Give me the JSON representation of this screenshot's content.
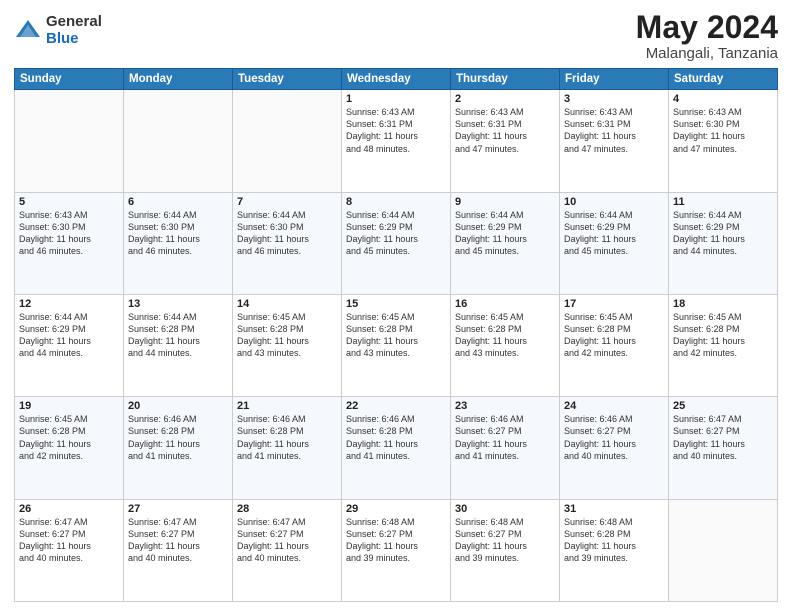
{
  "logo": {
    "general": "General",
    "blue": "Blue"
  },
  "title": "May 2024",
  "subtitle": "Malangali, Tanzania",
  "days_of_week": [
    "Sunday",
    "Monday",
    "Tuesday",
    "Wednesday",
    "Thursday",
    "Friday",
    "Saturday"
  ],
  "weeks": [
    [
      {
        "day": "",
        "info": ""
      },
      {
        "day": "",
        "info": ""
      },
      {
        "day": "",
        "info": ""
      },
      {
        "day": "1",
        "info": "Sunrise: 6:43 AM\nSunset: 6:31 PM\nDaylight: 11 hours\nand 48 minutes."
      },
      {
        "day": "2",
        "info": "Sunrise: 6:43 AM\nSunset: 6:31 PM\nDaylight: 11 hours\nand 47 minutes."
      },
      {
        "day": "3",
        "info": "Sunrise: 6:43 AM\nSunset: 6:31 PM\nDaylight: 11 hours\nand 47 minutes."
      },
      {
        "day": "4",
        "info": "Sunrise: 6:43 AM\nSunset: 6:30 PM\nDaylight: 11 hours\nand 47 minutes."
      }
    ],
    [
      {
        "day": "5",
        "info": "Sunrise: 6:43 AM\nSunset: 6:30 PM\nDaylight: 11 hours\nand 46 minutes."
      },
      {
        "day": "6",
        "info": "Sunrise: 6:44 AM\nSunset: 6:30 PM\nDaylight: 11 hours\nand 46 minutes."
      },
      {
        "day": "7",
        "info": "Sunrise: 6:44 AM\nSunset: 6:30 PM\nDaylight: 11 hours\nand 46 minutes."
      },
      {
        "day": "8",
        "info": "Sunrise: 6:44 AM\nSunset: 6:29 PM\nDaylight: 11 hours\nand 45 minutes."
      },
      {
        "day": "9",
        "info": "Sunrise: 6:44 AM\nSunset: 6:29 PM\nDaylight: 11 hours\nand 45 minutes."
      },
      {
        "day": "10",
        "info": "Sunrise: 6:44 AM\nSunset: 6:29 PM\nDaylight: 11 hours\nand 45 minutes."
      },
      {
        "day": "11",
        "info": "Sunrise: 6:44 AM\nSunset: 6:29 PM\nDaylight: 11 hours\nand 44 minutes."
      }
    ],
    [
      {
        "day": "12",
        "info": "Sunrise: 6:44 AM\nSunset: 6:29 PM\nDaylight: 11 hours\nand 44 minutes."
      },
      {
        "day": "13",
        "info": "Sunrise: 6:44 AM\nSunset: 6:28 PM\nDaylight: 11 hours\nand 44 minutes."
      },
      {
        "day": "14",
        "info": "Sunrise: 6:45 AM\nSunset: 6:28 PM\nDaylight: 11 hours\nand 43 minutes."
      },
      {
        "day": "15",
        "info": "Sunrise: 6:45 AM\nSunset: 6:28 PM\nDaylight: 11 hours\nand 43 minutes."
      },
      {
        "day": "16",
        "info": "Sunrise: 6:45 AM\nSunset: 6:28 PM\nDaylight: 11 hours\nand 43 minutes."
      },
      {
        "day": "17",
        "info": "Sunrise: 6:45 AM\nSunset: 6:28 PM\nDaylight: 11 hours\nand 42 minutes."
      },
      {
        "day": "18",
        "info": "Sunrise: 6:45 AM\nSunset: 6:28 PM\nDaylight: 11 hours\nand 42 minutes."
      }
    ],
    [
      {
        "day": "19",
        "info": "Sunrise: 6:45 AM\nSunset: 6:28 PM\nDaylight: 11 hours\nand 42 minutes."
      },
      {
        "day": "20",
        "info": "Sunrise: 6:46 AM\nSunset: 6:28 PM\nDaylight: 11 hours\nand 41 minutes."
      },
      {
        "day": "21",
        "info": "Sunrise: 6:46 AM\nSunset: 6:28 PM\nDaylight: 11 hours\nand 41 minutes."
      },
      {
        "day": "22",
        "info": "Sunrise: 6:46 AM\nSunset: 6:28 PM\nDaylight: 11 hours\nand 41 minutes."
      },
      {
        "day": "23",
        "info": "Sunrise: 6:46 AM\nSunset: 6:27 PM\nDaylight: 11 hours\nand 41 minutes."
      },
      {
        "day": "24",
        "info": "Sunrise: 6:46 AM\nSunset: 6:27 PM\nDaylight: 11 hours\nand 40 minutes."
      },
      {
        "day": "25",
        "info": "Sunrise: 6:47 AM\nSunset: 6:27 PM\nDaylight: 11 hours\nand 40 minutes."
      }
    ],
    [
      {
        "day": "26",
        "info": "Sunrise: 6:47 AM\nSunset: 6:27 PM\nDaylight: 11 hours\nand 40 minutes."
      },
      {
        "day": "27",
        "info": "Sunrise: 6:47 AM\nSunset: 6:27 PM\nDaylight: 11 hours\nand 40 minutes."
      },
      {
        "day": "28",
        "info": "Sunrise: 6:47 AM\nSunset: 6:27 PM\nDaylight: 11 hours\nand 40 minutes."
      },
      {
        "day": "29",
        "info": "Sunrise: 6:48 AM\nSunset: 6:27 PM\nDaylight: 11 hours\nand 39 minutes."
      },
      {
        "day": "30",
        "info": "Sunrise: 6:48 AM\nSunset: 6:27 PM\nDaylight: 11 hours\nand 39 minutes."
      },
      {
        "day": "31",
        "info": "Sunrise: 6:48 AM\nSunset: 6:28 PM\nDaylight: 11 hours\nand 39 minutes."
      },
      {
        "day": "",
        "info": ""
      }
    ]
  ]
}
